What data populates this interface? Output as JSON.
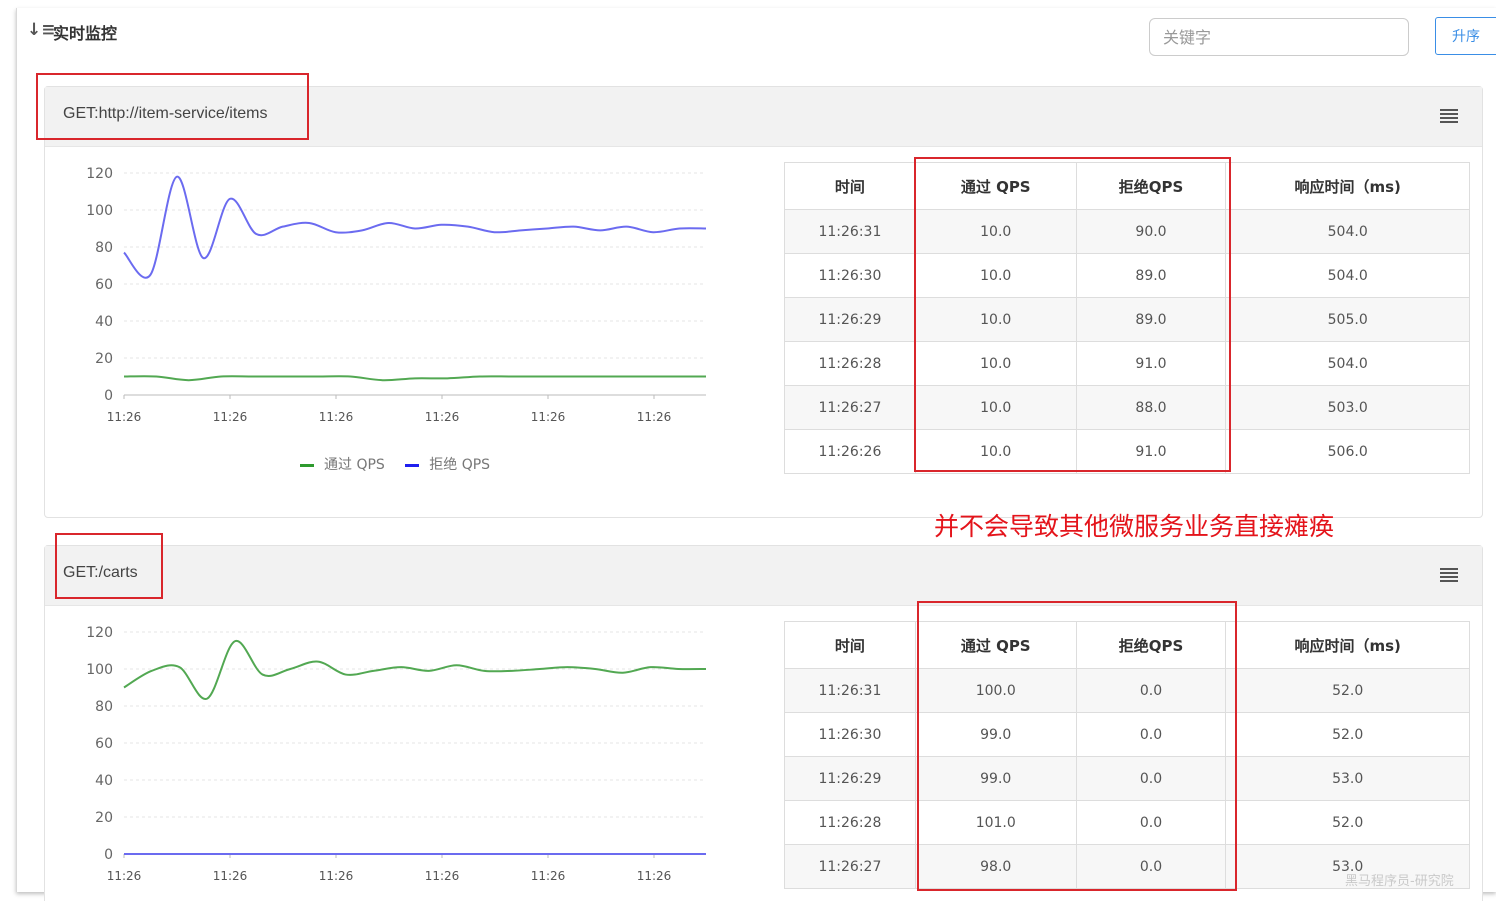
{
  "header": {
    "sort_icon": "sort-descending-icon",
    "title": "实时监控",
    "search_placeholder": "关键字",
    "sort_button": "升序"
  },
  "annotation": "并不会导致其他微服务业务直接瘫痪",
  "watermark": "黑马程序员-研究院",
  "colors": {
    "pass": "#52a852",
    "block": "#6b6bf0",
    "highlight": "#d9262c",
    "annotation": "#e4141b"
  },
  "cards": [
    {
      "resource": "GET:http://item-service/items",
      "menu_icon": "hamburger-menu-icon",
      "legend": {
        "pass": "通过 QPS",
        "block": "拒绝 QPS"
      },
      "table": {
        "headers": [
          "时间",
          "通过 QPS",
          "拒绝QPS",
          "响应时间（ms)"
        ],
        "rows": [
          [
            "11:26:31",
            "10.0",
            "90.0",
            "504.0"
          ],
          [
            "11:26:30",
            "10.0",
            "89.0",
            "504.0"
          ],
          [
            "11:26:29",
            "10.0",
            "89.0",
            "505.0"
          ],
          [
            "11:26:28",
            "10.0",
            "91.0",
            "504.0"
          ],
          [
            "11:26:27",
            "10.0",
            "88.0",
            "503.0"
          ],
          [
            "11:26:26",
            "10.0",
            "91.0",
            "506.0"
          ]
        ]
      }
    },
    {
      "resource": "GET:/carts",
      "menu_icon": "hamburger-menu-icon",
      "table": {
        "headers": [
          "时间",
          "通过 QPS",
          "拒绝QPS",
          "响应时间（ms)"
        ],
        "rows": [
          [
            "11:26:31",
            "100.0",
            "0.0",
            "52.0"
          ],
          [
            "11:26:30",
            "99.0",
            "0.0",
            "52.0"
          ],
          [
            "11:26:29",
            "99.0",
            "0.0",
            "53.0"
          ],
          [
            "11:26:28",
            "101.0",
            "0.0",
            "52.0"
          ],
          [
            "11:26:27",
            "98.0",
            "0.0",
            "53.0"
          ]
        ]
      }
    }
  ],
  "chart_data": [
    {
      "type": "line",
      "title": "",
      "x_tick_labels": [
        "11:26",
        "11:26",
        "11:26",
        "11:26",
        "11:26",
        "11:26"
      ],
      "y_ticks": [
        0,
        20,
        40,
        60,
        80,
        100,
        120
      ],
      "ylim": [
        0,
        120
      ],
      "grid": true,
      "legend_position": "bottom",
      "series": [
        {
          "name": "通过 QPS",
          "color": "#52a852",
          "values": [
            10,
            10,
            8,
            10,
            10,
            10,
            10,
            10,
            8,
            9,
            9,
            10,
            10,
            10,
            10,
            10,
            10,
            10,
            10
          ]
        },
        {
          "name": "拒绝 QPS",
          "color": "#6b6bf0",
          "values": [
            77,
            65,
            118,
            74,
            106,
            87,
            91,
            93,
            88,
            89,
            93,
            90,
            92,
            91,
            88,
            89,
            90,
            91,
            89,
            91,
            88,
            90,
            90
          ]
        }
      ]
    },
    {
      "type": "line",
      "title": "",
      "x_tick_labels": [
        "11:26",
        "11:26",
        "11:26",
        "11:26",
        "11:26",
        "11:26"
      ],
      "y_ticks": [
        0,
        20,
        40,
        60,
        80,
        100,
        120
      ],
      "ylim": [
        0,
        120
      ],
      "grid": true,
      "series": [
        {
          "color": "#52a852",
          "values": [
            90,
            99,
            101,
            84,
            115,
            97,
            100,
            104,
            97,
            99,
            101,
            99,
            102,
            99,
            99,
            100,
            101,
            100,
            98,
            101,
            100,
            100
          ]
        },
        {
          "color": "#6b6bf0",
          "values": [
            0,
            0,
            0,
            0,
            0,
            0,
            0,
            0,
            0,
            0,
            0,
            0,
            0,
            0,
            0,
            0,
            0,
            0,
            0,
            0,
            0,
            0
          ]
        }
      ]
    }
  ]
}
